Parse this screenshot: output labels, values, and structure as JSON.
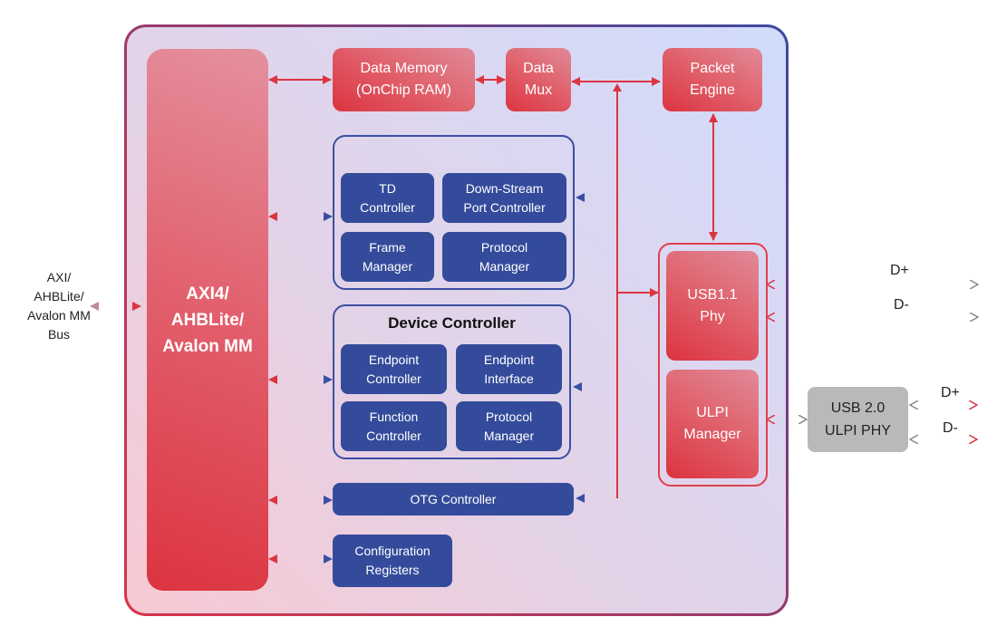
{
  "external_bus_label": "AXI/\nAHBLite/\nAvalon MM\nBus",
  "bus_interface": {
    "label": "AXI4/\nAHBLite/\nAvalon MM"
  },
  "data_memory": {
    "label": "Data Memory\n(OnChip RAM)"
  },
  "data_mux": {
    "label": "Data\nMux"
  },
  "packet_engine": {
    "label": "Packet\nEngine"
  },
  "host_controller": {
    "blocks": [
      {
        "label": "TD\nController"
      },
      {
        "label": "Down-Stream\nPort Controller"
      },
      {
        "label": "Frame\nManager"
      },
      {
        "label": "Protocol\nManager"
      }
    ]
  },
  "device_controller": {
    "title": "Device Controller",
    "blocks": [
      {
        "label": "Endpoint\nController"
      },
      {
        "label": "Endpoint\nInterface"
      },
      {
        "label": "Function\nController"
      },
      {
        "label": "Protocol\nManager"
      }
    ]
  },
  "otg_controller": {
    "label": "OTG Controller"
  },
  "config_registers": {
    "label": "Configuration\nRegisters"
  },
  "usb11_phy": {
    "label": "USB1.1\nPhy"
  },
  "ulpi_manager": {
    "label": "ULPI\nManager"
  },
  "ulpi_phy": {
    "label": "USB 2.0\nULPI PHY"
  },
  "signals": {
    "usb11_dplus": "D+",
    "usb11_dminus": "D-",
    "ulpi_dplus": "D+",
    "ulpi_dminus": "D-"
  },
  "colors": {
    "red_accent": "#dc3440",
    "blue_block": "#344b9b",
    "gray_block": "#b9b9b9"
  }
}
